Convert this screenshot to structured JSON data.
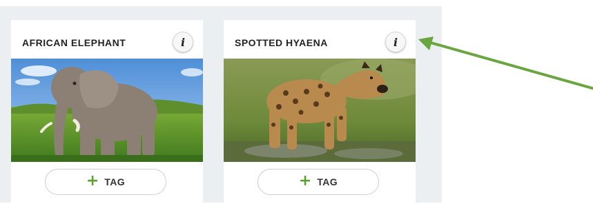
{
  "cards": [
    {
      "title": "AFRICAN ELEPHANT",
      "info_icon_glyph": "i",
      "image_subject": "african-elephant",
      "tag_button_label": "TAG",
      "tag_button_icon": "plus-icon"
    },
    {
      "title": "SPOTTED HYAENA",
      "info_icon_glyph": "i",
      "image_subject": "spotted-hyaena",
      "tag_button_label": "TAG",
      "tag_button_icon": "plus-icon"
    }
  ],
  "colors": {
    "panel_bg": "#eceff1",
    "tag_plus": "#5aa02c",
    "annotation_arrow": "#6aa63f"
  }
}
